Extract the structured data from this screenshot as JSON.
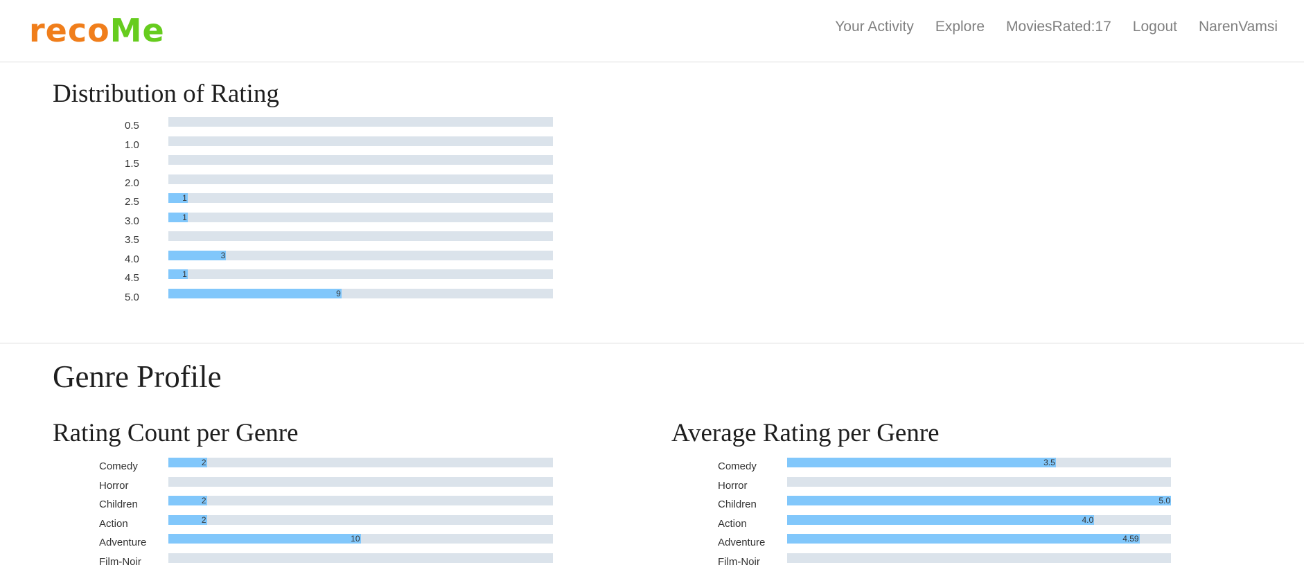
{
  "app": {
    "logo_part1": "reco",
    "logo_part2": "Me"
  },
  "nav": [
    {
      "id": "your-activity",
      "label": "Your Activity"
    },
    {
      "id": "explore",
      "label": "Explore"
    },
    {
      "id": "movies-rated",
      "label": "MoviesRated:17"
    },
    {
      "id": "logout",
      "label": "Logout"
    },
    {
      "id": "user",
      "label": "NarenVamsi"
    }
  ],
  "colors": {
    "bar_fill": "#81c7fb",
    "bar_track": "#dbe3eb",
    "logo_orange": "#f07e1b",
    "logo_green": "#66cc1e"
  },
  "sections": {
    "distribution_title": "Distribution of Rating",
    "genre_profile_title": "Genre Profile",
    "count_title": "Rating Count per Genre",
    "average_title": "Average Rating per Genre"
  },
  "chart_data": [
    {
      "type": "bar",
      "orientation": "horizontal",
      "title": "Distribution of Rating",
      "categories": [
        "0.5",
        "1.0",
        "1.5",
        "2.0",
        "2.5",
        "3.0",
        "3.5",
        "4.0",
        "4.5",
        "5.0"
      ],
      "values": [
        0,
        0,
        0,
        0,
        1,
        1,
        0,
        3,
        1,
        9
      ],
      "labels": [
        "",
        "",
        "",
        "",
        "1",
        "1",
        "",
        "3",
        "1",
        "9"
      ],
      "xlim": [
        0,
        20
      ]
    },
    {
      "type": "bar",
      "orientation": "horizontal",
      "title": "Rating Count per Genre",
      "categories": [
        "Comedy",
        "Horror",
        "Children",
        "Action",
        "Adventure",
        "Film-Noir"
      ],
      "values": [
        2,
        0,
        2,
        2,
        10,
        0
      ],
      "labels": [
        "2",
        "",
        "2",
        "2",
        "10",
        ""
      ],
      "xlim": [
        0,
        20
      ]
    },
    {
      "type": "bar",
      "orientation": "horizontal",
      "title": "Average Rating per Genre",
      "categories": [
        "Comedy",
        "Horror",
        "Children",
        "Action",
        "Adventure",
        "Film-Noir"
      ],
      "values": [
        3.5,
        0,
        5.0,
        4.0,
        4.59,
        0
      ],
      "labels": [
        "3.5",
        "",
        "5.0",
        "4.0",
        "4.59",
        ""
      ],
      "xlim": [
        0,
        5
      ]
    }
  ]
}
